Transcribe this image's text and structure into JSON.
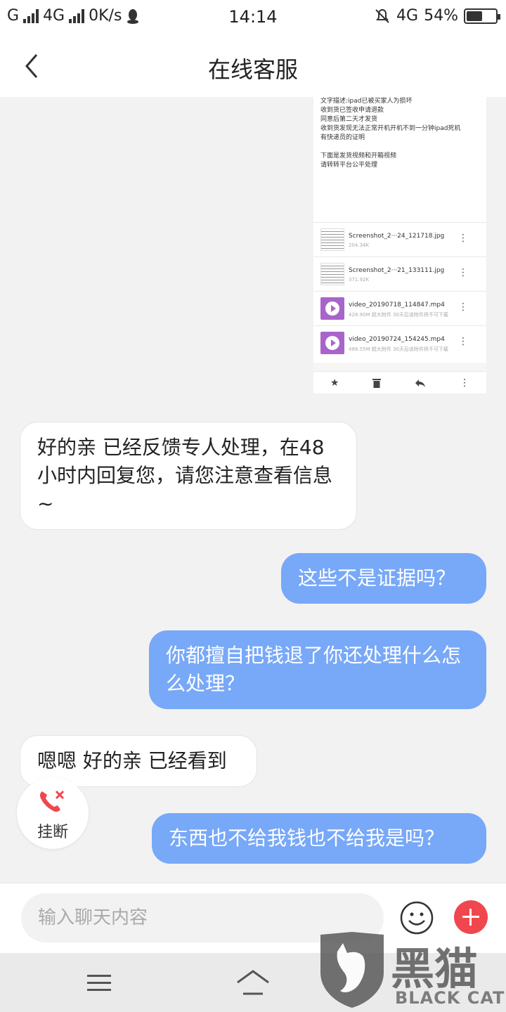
{
  "status_bar": {
    "carrier1": "G",
    "network": "4G",
    "speed": "0K/s",
    "time": "14:14",
    "net2": "4G",
    "battery_text": "54%",
    "battery_level": 0.54
  },
  "header": {
    "title": "在线客服"
  },
  "embedded_screenshot": {
    "lines": [
      "文字描述:ipad已被买家人为损坏",
      "收到货已签收申请退款",
      "同意后第二天才发货",
      "收到货发现无法正常开机开机不到一分钟ipad死机",
      "有快递员的证明",
      "",
      "下面是发货视频和开箱视频",
      "请转转平台公平处理"
    ],
    "attachments": [
      {
        "name": "Screenshot_2···24_121718.jpg",
        "size": "204.34K",
        "kind": "image"
      },
      {
        "name": "Screenshot_2···21_133111.jpg",
        "size": "371.92K",
        "kind": "image"
      },
      {
        "name": "video_20190718_114847.mp4",
        "size": "428.90M 超大附件    30天后该附件将不可下载",
        "kind": "video"
      },
      {
        "name": "video_20190724_154245.mp4",
        "size": "488.55M 超大附件    30天后该附件将不可下载",
        "kind": "video"
      }
    ],
    "action_icons": [
      "star-icon",
      "trash-icon",
      "reply-icon",
      "more-vertical-icon"
    ]
  },
  "messages": [
    {
      "side": "in",
      "text": "好的亲  已经反馈专人处理，在48小时内回复您，请您注意查看信息~"
    },
    {
      "side": "out",
      "text": "这些不是证据吗？"
    },
    {
      "side": "out",
      "text": "你都擅自把钱退了你还处理什么怎么处理？"
    },
    {
      "side": "in",
      "text": "嗯嗯 好的亲 已经看到"
    },
    {
      "side": "out",
      "text": "东西也不给我钱也不给我是吗？"
    }
  ],
  "hangup": {
    "label": "挂断",
    "icon": "phone-hangup-icon",
    "icon_color": "#f0474f"
  },
  "input": {
    "placeholder": "输入聊天内容",
    "emoji_icon": "smile-icon",
    "plus_icon": "plus-icon",
    "plus_color": "#f0474f"
  },
  "system_nav": {
    "menu_icon": "menu-icon",
    "home_icon": "home-icon"
  },
  "watermark": {
    "cn": "黑猫",
    "en": "BLACK CAT"
  },
  "colors": {
    "out_bubble": "#78a8f8",
    "background": "#f2f2f2"
  }
}
